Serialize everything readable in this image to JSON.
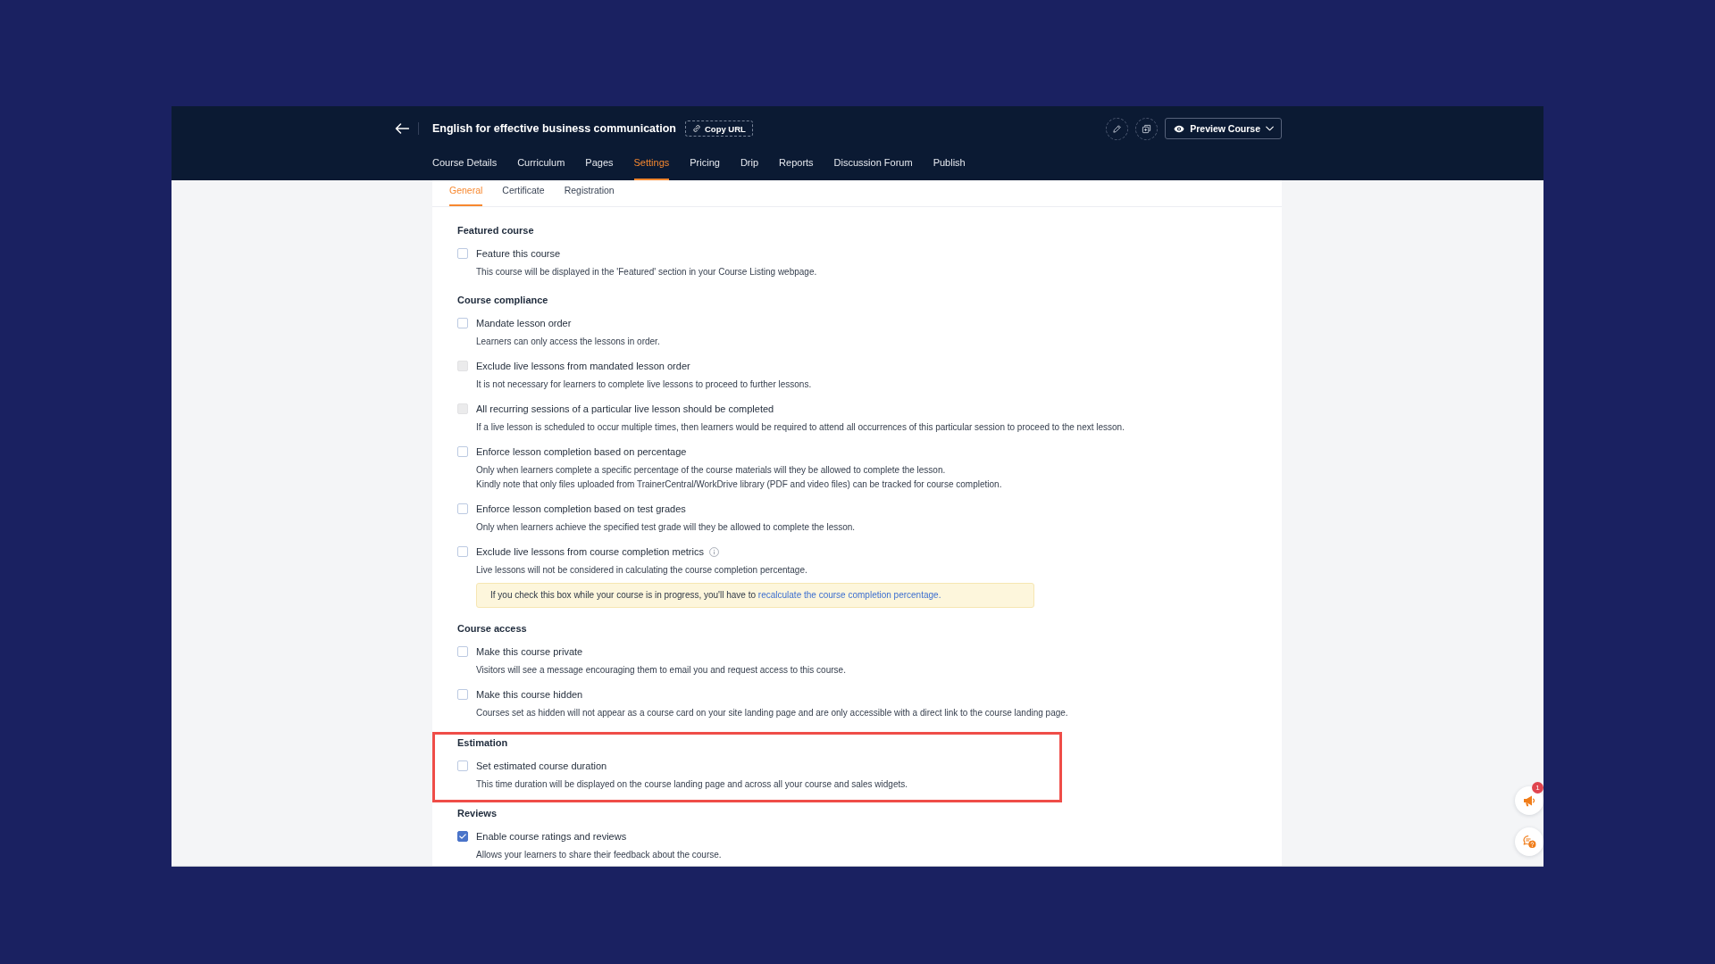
{
  "header": {
    "title": "English for effective business communication",
    "copy_url_button": "Copy URL",
    "preview_button": "Preview Course"
  },
  "nav_tabs": [
    {
      "label": "Course Details",
      "selected": false
    },
    {
      "label": "Curriculum",
      "selected": false
    },
    {
      "label": "Pages",
      "selected": false
    },
    {
      "label": "Settings",
      "selected": true
    },
    {
      "label": "Pricing",
      "selected": false
    },
    {
      "label": "Drip",
      "selected": false
    },
    {
      "label": "Reports",
      "selected": false
    },
    {
      "label": "Discussion Forum",
      "selected": false
    },
    {
      "label": "Publish",
      "selected": false
    }
  ],
  "sub_tabs": [
    {
      "label": "General",
      "selected": true
    },
    {
      "label": "Certificate",
      "selected": false
    },
    {
      "label": "Registration",
      "selected": false
    }
  ],
  "sections": [
    {
      "heading": "Featured course",
      "highlighted": false,
      "items": [
        {
          "label": "Feature this course",
          "checked": false,
          "disabled": false,
          "info": false,
          "description": [
            "This course will be displayed in the 'Featured' section in your Course Listing webpage."
          ]
        }
      ]
    },
    {
      "heading": "Course compliance",
      "highlighted": false,
      "items": [
        {
          "label": "Mandate lesson order",
          "checked": false,
          "disabled": false,
          "info": false,
          "description": [
            "Learners can only access the lessons in order."
          ]
        },
        {
          "label": "Exclude live lessons from mandated lesson order",
          "checked": false,
          "disabled": true,
          "info": false,
          "description": [
            "It is not necessary for learners to complete live lessons to proceed to further lessons."
          ]
        },
        {
          "label": "All recurring sessions of a particular live lesson should be completed",
          "checked": false,
          "disabled": true,
          "info": false,
          "description": [
            "If a live lesson is scheduled to occur multiple times, then learners would be required to attend all occurrences of this particular session to proceed to the next lesson."
          ]
        },
        {
          "label": "Enforce lesson completion based on percentage",
          "checked": false,
          "disabled": false,
          "info": false,
          "description": [
            "Only when learners complete a specific percentage of the course materials will they be allowed to complete the lesson.",
            "Kindly note that only files uploaded from TrainerCentral/WorkDrive library (PDF and video files) can be tracked for course completion."
          ]
        },
        {
          "label": "Enforce lesson completion based on test grades",
          "checked": false,
          "disabled": false,
          "info": false,
          "description": [
            "Only when learners achieve the specified test grade will they be allowed to complete the lesson."
          ]
        },
        {
          "label": "Exclude live lessons from course completion metrics",
          "checked": false,
          "disabled": false,
          "info": true,
          "description": [
            "Live lessons will not be considered in calculating the course completion percentage."
          ],
          "notice": {
            "text": "If you check this box while your course is in progress, you'll have to ",
            "link": "recalculate the course completion percentage."
          }
        }
      ]
    },
    {
      "heading": "Course access",
      "highlighted": false,
      "items": [
        {
          "label": "Make this course private",
          "checked": false,
          "disabled": false,
          "info": false,
          "description": [
            "Visitors will see a message encouraging them to email you and request access to this course."
          ]
        },
        {
          "label": "Make this course hidden",
          "checked": false,
          "disabled": false,
          "info": false,
          "description": [
            "Courses set as hidden will not appear as a course card on your site landing page and are only accessible with a direct link to the course landing page."
          ]
        }
      ]
    },
    {
      "heading": "Estimation",
      "highlighted": true,
      "items": [
        {
          "label": "Set estimated course duration",
          "checked": false,
          "disabled": false,
          "info": false,
          "description": [
            "This time duration will be displayed on the course landing page and across all your course and sales widgets."
          ]
        }
      ]
    },
    {
      "heading": "Reviews",
      "highlighted": false,
      "items": [
        {
          "label": "Enable course ratings and reviews",
          "checked": true,
          "disabled": false,
          "info": false,
          "description": [
            "Allows your learners to share their feedback about the course."
          ]
        }
      ]
    }
  ],
  "widgets": {
    "announcement_badge": "1"
  }
}
